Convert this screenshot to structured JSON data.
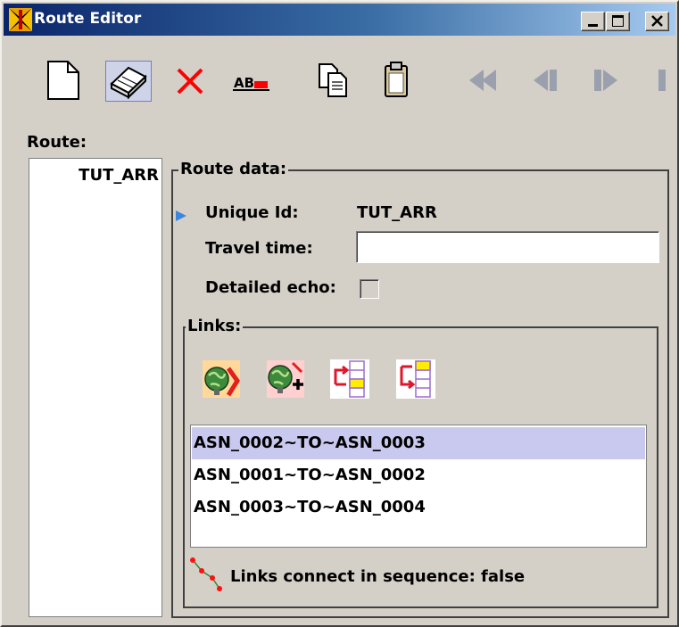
{
  "window": {
    "title": "Route Editor",
    "controls": [
      "minimize",
      "maximize",
      "close"
    ]
  },
  "toolbar": {
    "items": [
      {
        "name": "new",
        "icon": "new-document-icon"
      },
      {
        "name": "eraser",
        "icon": "eraser-icon",
        "selected": true
      },
      {
        "name": "delete",
        "icon": "delete-x-icon"
      },
      {
        "name": "rename",
        "icon": "rename-icon",
        "text": "AB"
      },
      {
        "name": "copy",
        "icon": "copy-icon"
      },
      {
        "name": "paste",
        "icon": "paste-clipboard-icon"
      },
      {
        "name": "first",
        "icon": "first-icon",
        "enabled": false
      },
      {
        "name": "previous",
        "icon": "previous-icon",
        "enabled": false
      },
      {
        "name": "next",
        "icon": "next-icon",
        "enabled": false
      },
      {
        "name": "last",
        "icon": "last-icon",
        "enabled": false
      }
    ]
  },
  "route_panel": {
    "label": "Route:",
    "items": [
      "TUT_ARR"
    ]
  },
  "route_data": {
    "group_title": "Route data:",
    "unique_id_label": "Unique Id:",
    "unique_id_value": "TUT_ARR",
    "travel_time_label": "Travel time:",
    "travel_time_value": "",
    "detailed_echo_label": "Detailed echo:",
    "detailed_echo_checked": false
  },
  "links": {
    "group_title": "Links:",
    "buttons": [
      {
        "icon": "globe-remove-icon"
      },
      {
        "icon": "globe-add-icon"
      },
      {
        "icon": "insert-link-before-icon"
      },
      {
        "icon": "insert-link-after-icon"
      }
    ],
    "items": [
      "ASN_0002~TO~ASN_0003",
      "ASN_0001~TO~ASN_0002",
      "ASN_0003~TO~ASN_0004"
    ],
    "selected_index": 0,
    "status": "Links connect in sequence: false"
  },
  "colors": {
    "titlebar_start": "#0a246a",
    "titlebar_end": "#a6caf0",
    "window_bg": "#d4d0c8",
    "selection": "#c9c9ef",
    "delete_red": "#ff0000"
  }
}
